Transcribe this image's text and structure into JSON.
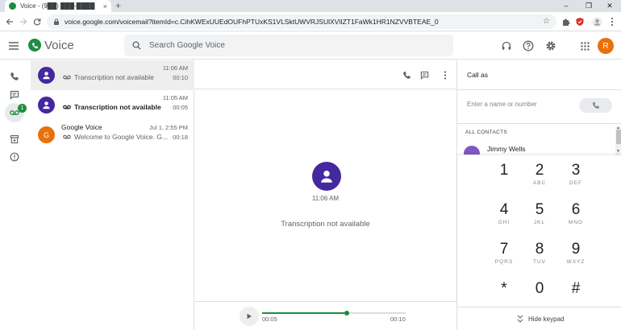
{
  "browser": {
    "tab_title": "Voice - (9██) ███-████",
    "tab_close": "×",
    "new_tab": "+",
    "url": "voice.google.com/voicemail?itemId=c.CihKWExUUEdOUFhPTUxKS1VLSktUWVRJSUlXVlIZT1FaWk1HR1NZVVBTEAE_0",
    "window_controls": {
      "minimize": "–",
      "maximize": "❒",
      "close": "✕"
    }
  },
  "app": {
    "name": "Voice",
    "search_placeholder": "Search Google Voice",
    "account_initial": "R",
    "accent_color": "#1e8e3e"
  },
  "rail": {
    "voicemail_badge": "1"
  },
  "voicemails": [
    {
      "name": "",
      "preview": "Transcription not available",
      "time": "11:06 AM",
      "duration": "00:10",
      "avatar_color": "#4527a0",
      "avatar_letter": "",
      "bold": false,
      "selected": true
    },
    {
      "name": "",
      "preview": "Transcription not available",
      "time": "11:05 AM",
      "duration": "00:05",
      "avatar_color": "#4527a0",
      "avatar_letter": "",
      "bold": true,
      "selected": false
    },
    {
      "name": "Google Voice",
      "preview": "Welcome to Google Voice. G...",
      "time": "Jul 1, 2:55 PM",
      "duration": "00:18",
      "avatar_color": "#e8710a",
      "avatar_letter": "G",
      "bold": false,
      "selected": false
    }
  ],
  "detail": {
    "time": "11:06 AM",
    "transcription": "Transcription not available",
    "player": {
      "elapsed": "00:05",
      "total": "00:10",
      "progress": 0.59
    }
  },
  "call_panel": {
    "title": "Call as",
    "input_placeholder": "Enter a name or number",
    "contacts_header": "ALL CONTACTS",
    "contact_name": "Jimmy Wells",
    "keys": [
      {
        "digit": "1",
        "letters": ""
      },
      {
        "digit": "2",
        "letters": "ABC"
      },
      {
        "digit": "3",
        "letters": "DEF"
      },
      {
        "digit": "4",
        "letters": "GHI"
      },
      {
        "digit": "5",
        "letters": "JKL"
      },
      {
        "digit": "6",
        "letters": "MNO"
      },
      {
        "digit": "7",
        "letters": "PQRS"
      },
      {
        "digit": "8",
        "letters": "TUV"
      },
      {
        "digit": "9",
        "letters": "WXYZ"
      },
      {
        "digit": "*",
        "letters": ""
      },
      {
        "digit": "0",
        "letters": ""
      },
      {
        "digit": "#",
        "letters": ""
      }
    ],
    "hide_keypad": "Hide keypad"
  }
}
